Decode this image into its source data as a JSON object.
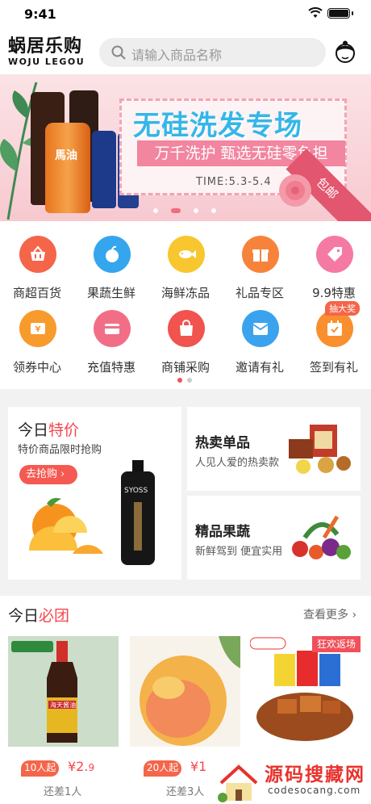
{
  "status_bar": {
    "time": "9:41"
  },
  "header": {
    "logo_cn": "蜗居乐购",
    "logo_en": "WOJU LEGOU",
    "search_placeholder": "请输入商品名称"
  },
  "banner": {
    "title": "无硅洗发专场",
    "subtitle": "万千洗护 甄选无硅零负担",
    "time": "TIME:5.3-5.4",
    "ribbon": "包邮",
    "bottle_label": "馬油",
    "page_count": 4,
    "active_index": 1
  },
  "categories": [
    {
      "label": "商超百货",
      "icon": "basket-icon",
      "color": "#f4654a"
    },
    {
      "label": "果蔬生鲜",
      "icon": "apple-icon",
      "color": "#35a6ee"
    },
    {
      "label": "海鲜冻品",
      "icon": "fish-icon",
      "color": "#f8c62f"
    },
    {
      "label": "礼品专区",
      "icon": "gift-icon",
      "color": "#f7833a"
    },
    {
      "label": "9.9特惠",
      "icon": "tag-icon",
      "color": "#f47aa4"
    },
    {
      "label": "领券中心",
      "icon": "coupon-icon",
      "color": "#f79b2c"
    },
    {
      "label": "充值特惠",
      "icon": "card-icon",
      "color": "#f16e86"
    },
    {
      "label": "商铺采购",
      "icon": "bag-icon",
      "color": "#f1534f"
    },
    {
      "label": "邀请有礼",
      "icon": "envelope-icon",
      "color": "#3ba3ee"
    },
    {
      "label": "签到有礼",
      "icon": "calendar-icon",
      "color": "#f98f2e"
    }
  ],
  "badge_label": "抽大奖",
  "today_special": {
    "title_prefix": "今日",
    "title_highlight": "特价",
    "desc": "特价商品限时抢购",
    "button": "去抢购",
    "product_brand": "SYOSS"
  },
  "hot_item": {
    "title": "热卖单品",
    "desc": "人见人爱的热卖款"
  },
  "quality_fruit": {
    "title": "精品果蔬",
    "desc": "新鲜驾到 便宜实用"
  },
  "group_buy": {
    "title_prefix": "今日",
    "title_highlight": "必团",
    "more": "查看更多",
    "items": [
      {
        "min": "10人起",
        "price": "¥2.",
        "price_small": "9",
        "remain": "还差1人",
        "img_label": "海天酱油"
      },
      {
        "min": "20人起",
        "price": "¥1",
        "price_small": "",
        "remain": "还差3人",
        "img_label": ""
      },
      {
        "min": "",
        "price": "",
        "price_small": "",
        "remain": "",
        "img_label": "狂欢返场"
      }
    ]
  },
  "watermark": {
    "title": "源码搜藏网",
    "url": "codesocang.com"
  },
  "colors": {
    "accent": "#f5464c",
    "pink": "#f06277"
  }
}
